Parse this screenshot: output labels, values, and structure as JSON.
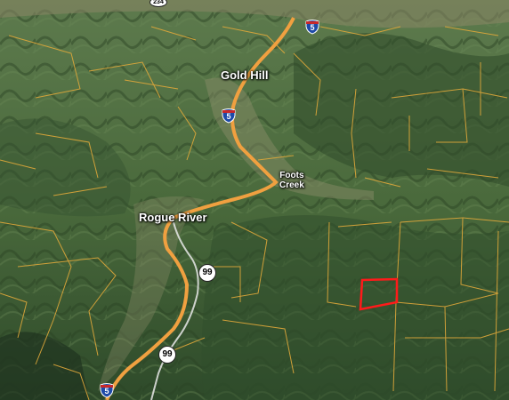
{
  "map": {
    "type": "satellite-3d-terrain",
    "colors": {
      "terrain_dark": "#2f4a2a",
      "terrain_mid": "#4f6e3f",
      "valley": "#8a8a6a",
      "parcel_lines": "#e0a83a",
      "highway": "#f0a040",
      "selected_parcel": "#ff1a1a"
    }
  },
  "labels": {
    "gold_hill": "Gold Hill",
    "foots_creek_line1": "Foots",
    "foots_creek_line2": "Creek",
    "rogue_river": "Rogue River"
  },
  "shields": {
    "i5_top": "5",
    "i5_mid": "5",
    "i5_bottom": "5",
    "hwy99_upper": "99",
    "hwy99_lower": "99",
    "hwy234_top": "234"
  },
  "icons": {
    "interstate": "interstate-shield-icon",
    "state_route": "state-route-shield-icon",
    "parcel": "selected-parcel-outline"
  }
}
